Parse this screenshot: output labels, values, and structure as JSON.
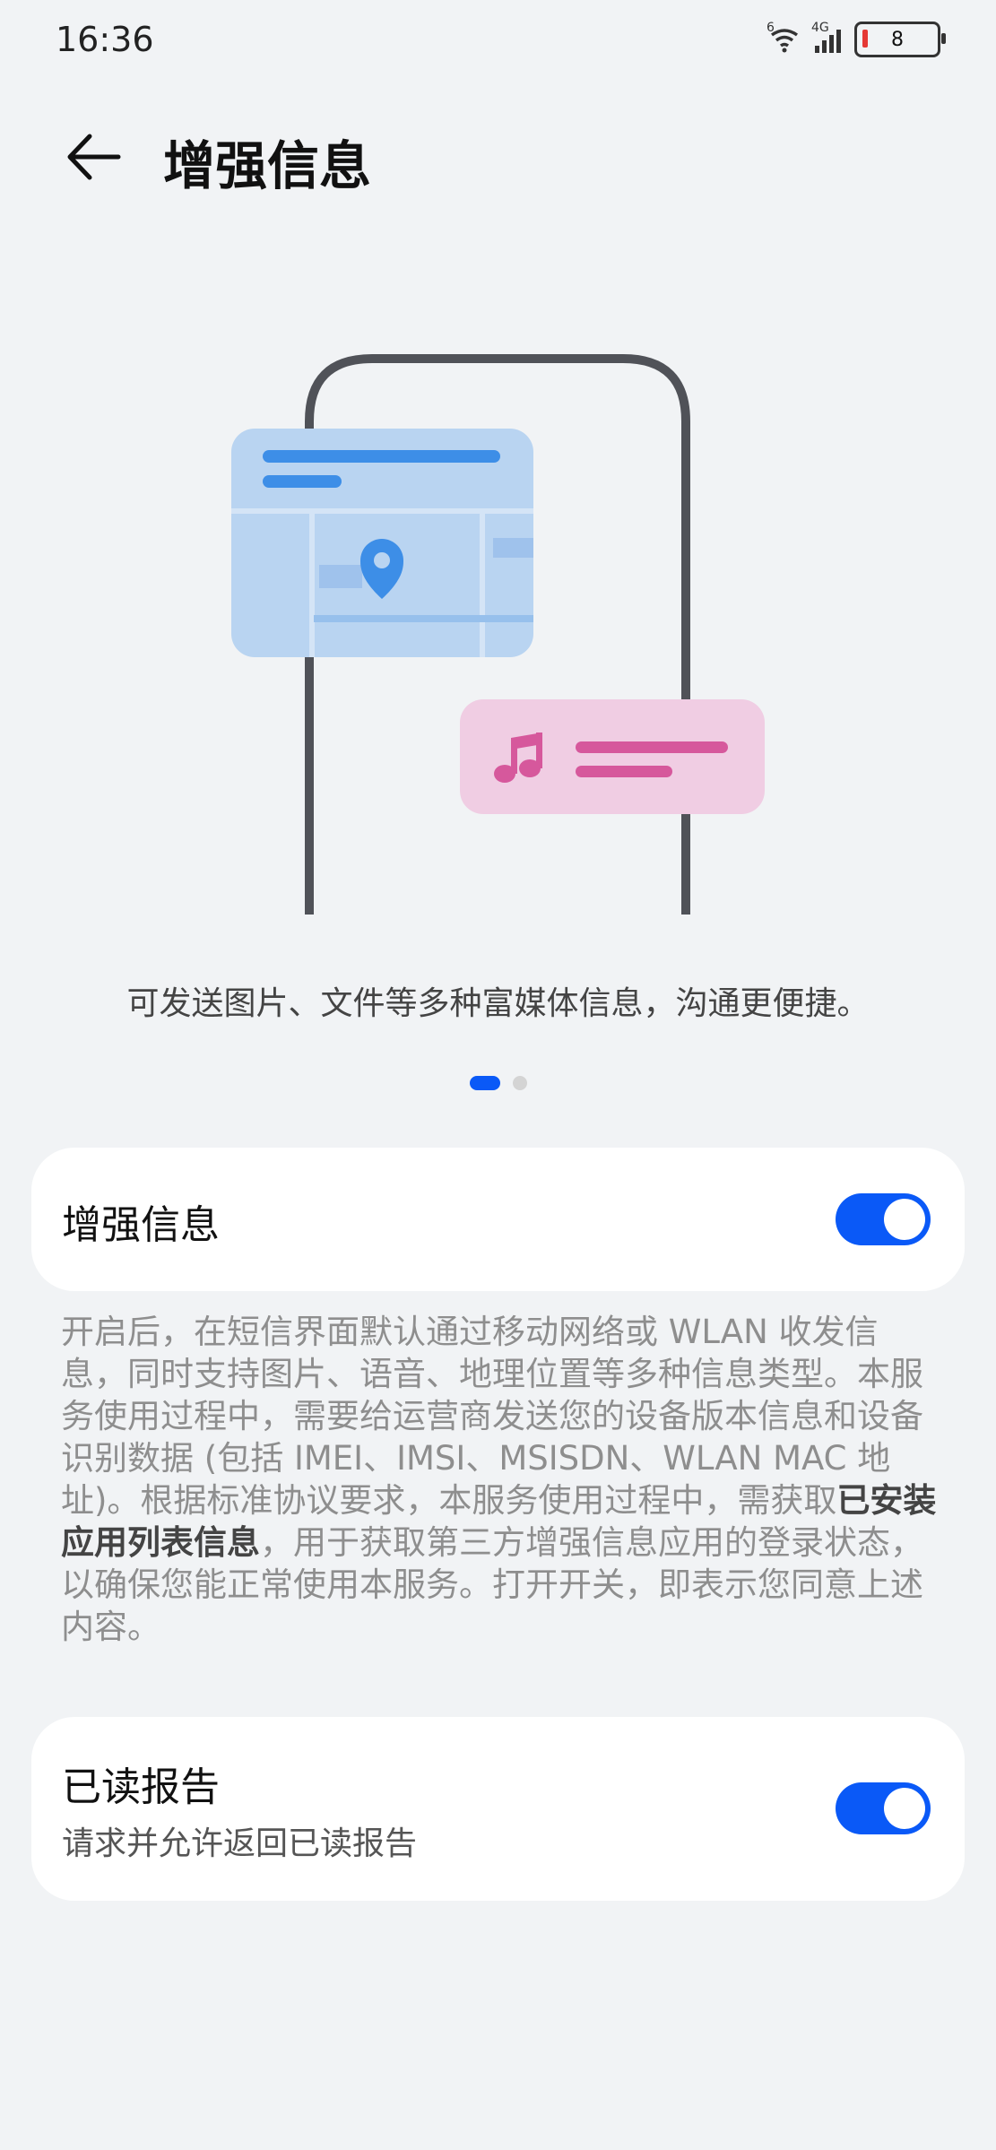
{
  "status_bar": {
    "time": "16:36",
    "wifi_badge": "6",
    "network_type": "4G",
    "battery_level": "8",
    "icons": [
      "wifi-icon",
      "cellular-signal-icon",
      "battery-icon"
    ]
  },
  "header": {
    "title": "增强信息",
    "back_icon": "back-arrow-icon"
  },
  "illustration": {
    "icons": [
      "phone-outline",
      "map-card-icon",
      "location-pin-icon",
      "music-note-icon"
    ],
    "colors": {
      "map_card": "#b9d4f1",
      "map_accent": "#3d8ee7",
      "music_card": "#f0cde3",
      "music_accent": "#d6589c",
      "phone_frame": "#505258"
    }
  },
  "caption": "可发送图片、文件等多种富媒体信息，沟通更便捷。",
  "pager": {
    "total": 2,
    "active_index": 0
  },
  "enhanced_messaging": {
    "label": "增强信息",
    "enabled": true
  },
  "description": {
    "part1": "开启后，在短信界面默认通过移动网络或 WLAN 收发信息，同时支持图片、语音、地理位置等多种信息类型。本服务使用过程中，需要给运营商发送您的设备版本信息和设备识别数据 (包括 IMEI、IMSI、MSISDN、WLAN MAC 地址)。根据标准协议要求，本服务使用过程中，需获取",
    "bold": "已安装应用列表信息",
    "part2": "，用于获取第三方增强信息应用的登录状态，以确保您能正常使用本服务。打开开关，即表示您同意上述内容。"
  },
  "read_report": {
    "label": "已读报告",
    "subtitle": "请求并允许返回已读报告",
    "enabled": true
  },
  "colors": {
    "accent": "#0a59f7",
    "background": "#f1f3f5",
    "card": "#ffffff"
  }
}
